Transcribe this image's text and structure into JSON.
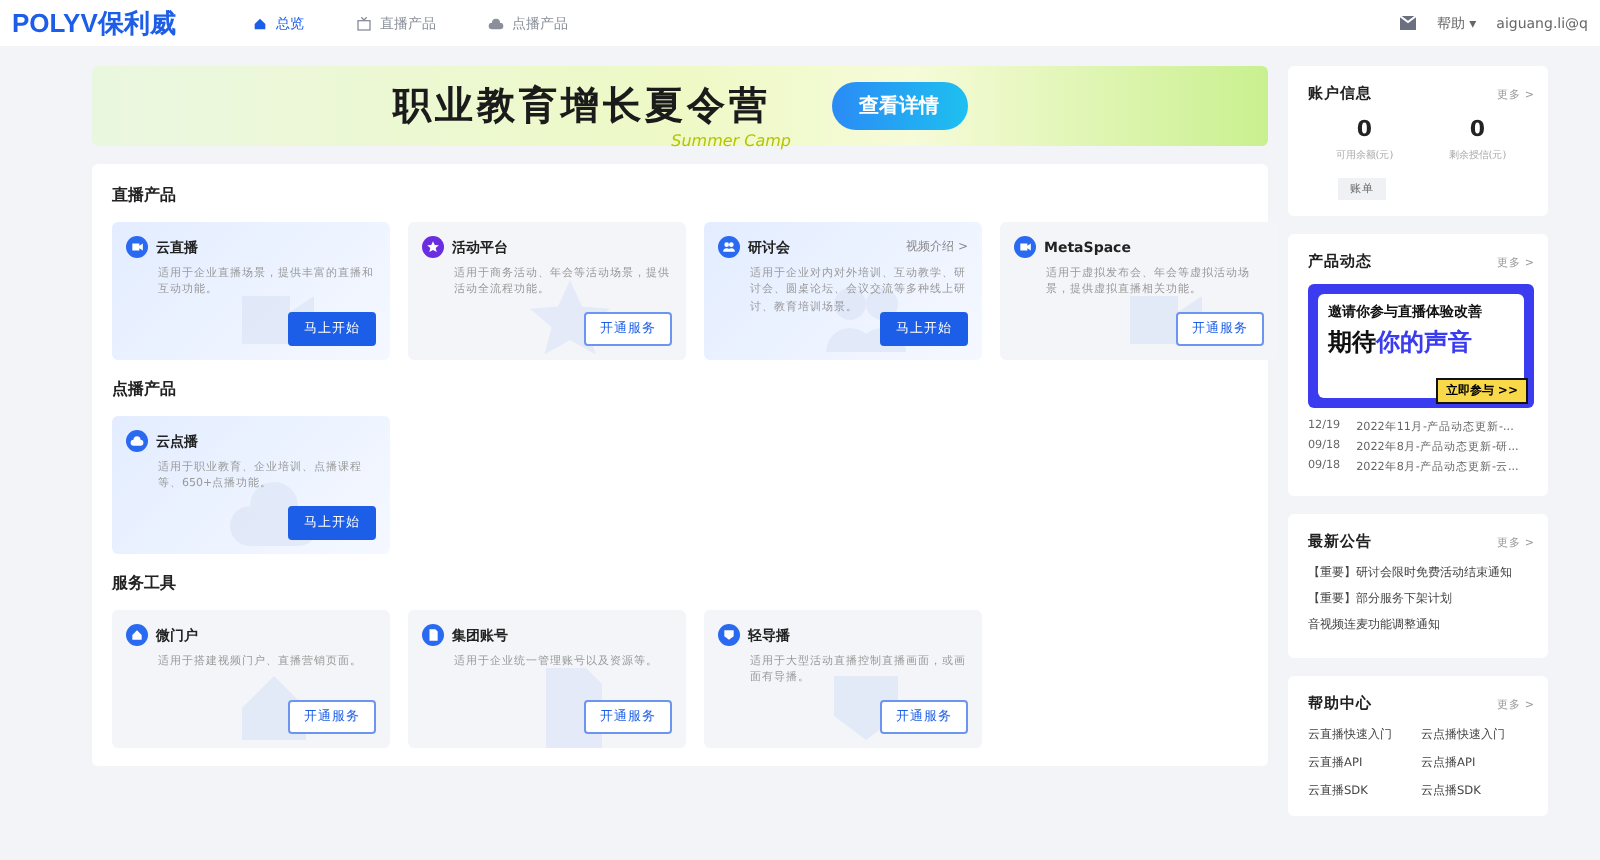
{
  "header": {
    "logo": "POLYV保利威",
    "nav": [
      {
        "label": "总览",
        "selected": true
      },
      {
        "label": "直播产品",
        "selected": false
      },
      {
        "label": "点播产品",
        "selected": false
      }
    ],
    "help": "帮助",
    "help_caret": "▾",
    "user": "aiguang.li@q"
  },
  "banner": {
    "title": "职业教育增长夏令营",
    "subtitle": "Summer Camp",
    "button": "查看详情"
  },
  "sections": [
    {
      "title": "直播产品",
      "cards": [
        {
          "name": "云直播",
          "desc": "适用于企业直播场景，提供丰富的直播和互动功能。",
          "button": {
            "label": "马上开始",
            "kind": "primary"
          }
        },
        {
          "name": "活动平台",
          "desc": "适用于商务活动、年会等活动场景，提供活动全流程功能。",
          "button": {
            "label": "开通服务",
            "kind": "outline"
          }
        },
        {
          "name": "研讨会",
          "link": "视频介绍 >",
          "desc": "适用于企业对内对外培训、互动教学、研讨会、圆桌论坛、会议交流等多种线上研讨、教育培训场景。",
          "button": {
            "label": "马上开始",
            "kind": "primary"
          }
        },
        {
          "name": "MetaSpace",
          "desc": "适用于虚拟发布会、年会等虚拟活动场景，提供虚拟直播相关功能。",
          "button": {
            "label": "开通服务",
            "kind": "outline"
          }
        }
      ]
    },
    {
      "title": "点播产品",
      "cards": [
        {
          "name": "云点播",
          "desc": "适用于职业教育、企业培训、点播课程等、650+点播功能。",
          "button": {
            "label": "马上开始",
            "kind": "primary"
          }
        }
      ]
    },
    {
      "title": "服务工具",
      "cards": [
        {
          "name": "微门户",
          "desc": "适用于搭建视频门户、直播营销页面。",
          "button": {
            "label": "开通服务",
            "kind": "outline"
          }
        },
        {
          "name": "集团账号",
          "desc": "适用于企业统一管理账号以及资源等。",
          "button": {
            "label": "开通服务",
            "kind": "outline"
          }
        },
        {
          "name": "轻导播",
          "desc": "适用于大型活动直播控制直播画面，或画面有导播。",
          "button": {
            "label": "开通服务",
            "kind": "outline"
          }
        }
      ]
    }
  ],
  "sidebar": {
    "account": {
      "title": "账户信息",
      "more": "更多 >",
      "stats": [
        {
          "value": "0",
          "label": "可用余额(元)"
        },
        {
          "value": "0",
          "label": "剩余授信(元)"
        }
      ],
      "button": "账单"
    },
    "updates": {
      "title": "产品动态",
      "more": "更多 >",
      "promo": {
        "line1": "邀请你参与直播体验改善",
        "line2a": "期待",
        "line2b": "你的声音",
        "cta": "立即参与 >>"
      },
      "items": [
        {
          "date": "12/19",
          "text": "2022年11月-产品动态更新-..."
        },
        {
          "date": "09/18",
          "text": "2022年8月-产品动态更新-研..."
        },
        {
          "date": "09/18",
          "text": "2022年8月-产品动态更新-云..."
        }
      ]
    },
    "notices": {
      "title": "最新公告",
      "more": "更多 >",
      "items": [
        "【重要】研讨会限时免费活动结束通知",
        "【重要】部分服务下架计划",
        "音视频连麦功能调整通知"
      ]
    },
    "help": {
      "title": "帮助中心",
      "more": "更多 >",
      "links": [
        "云直播快速入门",
        "云点播快速入门",
        "云直播API",
        "云点播API",
        "云直播SDK",
        "云点播SDK"
      ]
    }
  }
}
